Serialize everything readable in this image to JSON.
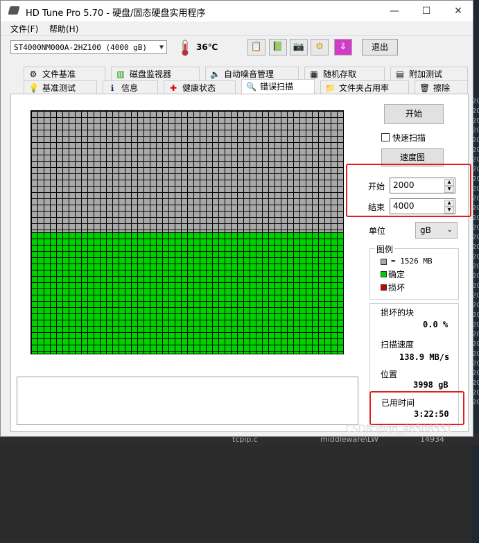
{
  "window": {
    "title": "HD Tune Pro 5.70 - 硬盘/固态硬盘实用程序",
    "minimize": "—",
    "maximize": "☐",
    "close": "✕"
  },
  "menu": {
    "file": "文件(F)",
    "help": "帮助(H)"
  },
  "toolbar": {
    "drive": "ST4000NM000A-2HZ100 (4000 gB)",
    "temperature": "36℃",
    "exit_label": "退出",
    "icons": [
      "copy-icon",
      "copy-all-icon",
      "camera-icon",
      "options-icon",
      "download-icon"
    ]
  },
  "tabs_row1": [
    {
      "label": "文件基准",
      "icon": "file-benchmark-icon"
    },
    {
      "label": "磁盘监视器",
      "icon": "disk-monitor-icon"
    },
    {
      "label": "自动噪音管理",
      "icon": "speaker-icon"
    },
    {
      "label": "随机存取",
      "icon": "random-access-icon"
    },
    {
      "label": "附加测试",
      "icon": "extra-tests-icon"
    }
  ],
  "tabs_row2": [
    {
      "label": "基准测试",
      "icon": "benchmark-icon"
    },
    {
      "label": "信息",
      "icon": "info-icon"
    },
    {
      "label": "健康状态",
      "icon": "health-icon"
    },
    {
      "label": "错误扫描",
      "icon": "search-icon",
      "active": true
    },
    {
      "label": "文件夹占用率",
      "icon": "folder-icon"
    },
    {
      "label": "擦除",
      "icon": "erase-icon"
    }
  ],
  "scan": {
    "start_button": "开始",
    "quick_scan_label": "快速扫描",
    "quick_scan_checked": false,
    "speed_map_button": "速度图",
    "start_label": "开始",
    "start_value": "2000",
    "end_label": "结束",
    "end_value": "4000",
    "unit_label": "单位",
    "unit_value": "gB",
    "progress_fraction": 0.5
  },
  "legend": {
    "title": "图例",
    "block_size": "= 1526 MB",
    "ok": "确定",
    "damaged": "损坏",
    "colors": {
      "untested": "#a9a9a9",
      "ok": "#00d200",
      "damaged": "#d00000"
    }
  },
  "stats": {
    "damaged_label": "损坏的块",
    "damaged_value": "0.0 %",
    "speed_label": "扫描速度",
    "speed_value": "138.9 MB/s",
    "position_label": "位置",
    "position_value": "3998 gB",
    "elapsed_label": "已用时间",
    "elapsed_value": "3:22:50"
  },
  "watermark": "CSDN @qq_46508551",
  "background_taskbar": [
    "tcpip.c",
    "middleware\\LW",
    "14934"
  ],
  "background_numbers": [
    "20",
    "20",
    "20",
    "20",
    "20",
    "20",
    "20",
    "20",
    "20",
    "20",
    "20",
    "20",
    "20",
    "20",
    "20",
    "20",
    "20",
    "20",
    "20",
    "20",
    "20",
    "20",
    "20",
    "20",
    "20",
    "20",
    "20",
    "20",
    "20",
    "20",
    "20",
    "20"
  ]
}
